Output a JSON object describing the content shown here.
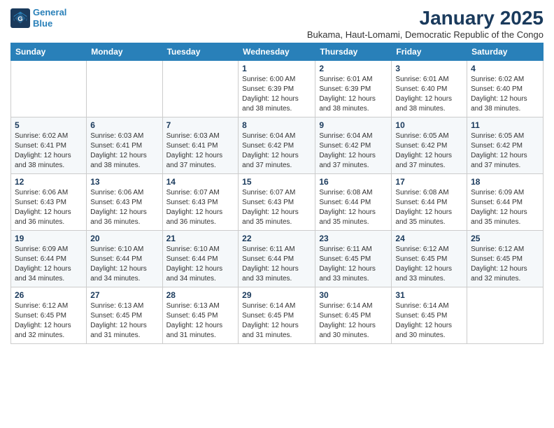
{
  "logo": {
    "line1": "General",
    "line2": "Blue"
  },
  "title": "January 2025",
  "subtitle": "Bukama, Haut-Lomami, Democratic Republic of the Congo",
  "weekdays": [
    "Sunday",
    "Monday",
    "Tuesday",
    "Wednesday",
    "Thursday",
    "Friday",
    "Saturday"
  ],
  "weeks": [
    [
      {
        "day": "",
        "info": ""
      },
      {
        "day": "",
        "info": ""
      },
      {
        "day": "",
        "info": ""
      },
      {
        "day": "1",
        "info": "Sunrise: 6:00 AM\nSunset: 6:39 PM\nDaylight: 12 hours\nand 38 minutes."
      },
      {
        "day": "2",
        "info": "Sunrise: 6:01 AM\nSunset: 6:39 PM\nDaylight: 12 hours\nand 38 minutes."
      },
      {
        "day": "3",
        "info": "Sunrise: 6:01 AM\nSunset: 6:40 PM\nDaylight: 12 hours\nand 38 minutes."
      },
      {
        "day": "4",
        "info": "Sunrise: 6:02 AM\nSunset: 6:40 PM\nDaylight: 12 hours\nand 38 minutes."
      }
    ],
    [
      {
        "day": "5",
        "info": "Sunrise: 6:02 AM\nSunset: 6:41 PM\nDaylight: 12 hours\nand 38 minutes."
      },
      {
        "day": "6",
        "info": "Sunrise: 6:03 AM\nSunset: 6:41 PM\nDaylight: 12 hours\nand 38 minutes."
      },
      {
        "day": "7",
        "info": "Sunrise: 6:03 AM\nSunset: 6:41 PM\nDaylight: 12 hours\nand 37 minutes."
      },
      {
        "day": "8",
        "info": "Sunrise: 6:04 AM\nSunset: 6:42 PM\nDaylight: 12 hours\nand 37 minutes."
      },
      {
        "day": "9",
        "info": "Sunrise: 6:04 AM\nSunset: 6:42 PM\nDaylight: 12 hours\nand 37 minutes."
      },
      {
        "day": "10",
        "info": "Sunrise: 6:05 AM\nSunset: 6:42 PM\nDaylight: 12 hours\nand 37 minutes."
      },
      {
        "day": "11",
        "info": "Sunrise: 6:05 AM\nSunset: 6:42 PM\nDaylight: 12 hours\nand 37 minutes."
      }
    ],
    [
      {
        "day": "12",
        "info": "Sunrise: 6:06 AM\nSunset: 6:43 PM\nDaylight: 12 hours\nand 36 minutes."
      },
      {
        "day": "13",
        "info": "Sunrise: 6:06 AM\nSunset: 6:43 PM\nDaylight: 12 hours\nand 36 minutes."
      },
      {
        "day": "14",
        "info": "Sunrise: 6:07 AM\nSunset: 6:43 PM\nDaylight: 12 hours\nand 36 minutes."
      },
      {
        "day": "15",
        "info": "Sunrise: 6:07 AM\nSunset: 6:43 PM\nDaylight: 12 hours\nand 35 minutes."
      },
      {
        "day": "16",
        "info": "Sunrise: 6:08 AM\nSunset: 6:44 PM\nDaylight: 12 hours\nand 35 minutes."
      },
      {
        "day": "17",
        "info": "Sunrise: 6:08 AM\nSunset: 6:44 PM\nDaylight: 12 hours\nand 35 minutes."
      },
      {
        "day": "18",
        "info": "Sunrise: 6:09 AM\nSunset: 6:44 PM\nDaylight: 12 hours\nand 35 minutes."
      }
    ],
    [
      {
        "day": "19",
        "info": "Sunrise: 6:09 AM\nSunset: 6:44 PM\nDaylight: 12 hours\nand 34 minutes."
      },
      {
        "day": "20",
        "info": "Sunrise: 6:10 AM\nSunset: 6:44 PM\nDaylight: 12 hours\nand 34 minutes."
      },
      {
        "day": "21",
        "info": "Sunrise: 6:10 AM\nSunset: 6:44 PM\nDaylight: 12 hours\nand 34 minutes."
      },
      {
        "day": "22",
        "info": "Sunrise: 6:11 AM\nSunset: 6:44 PM\nDaylight: 12 hours\nand 33 minutes."
      },
      {
        "day": "23",
        "info": "Sunrise: 6:11 AM\nSunset: 6:45 PM\nDaylight: 12 hours\nand 33 minutes."
      },
      {
        "day": "24",
        "info": "Sunrise: 6:12 AM\nSunset: 6:45 PM\nDaylight: 12 hours\nand 33 minutes."
      },
      {
        "day": "25",
        "info": "Sunrise: 6:12 AM\nSunset: 6:45 PM\nDaylight: 12 hours\nand 32 minutes."
      }
    ],
    [
      {
        "day": "26",
        "info": "Sunrise: 6:12 AM\nSunset: 6:45 PM\nDaylight: 12 hours\nand 32 minutes."
      },
      {
        "day": "27",
        "info": "Sunrise: 6:13 AM\nSunset: 6:45 PM\nDaylight: 12 hours\nand 31 minutes."
      },
      {
        "day": "28",
        "info": "Sunrise: 6:13 AM\nSunset: 6:45 PM\nDaylight: 12 hours\nand 31 minutes."
      },
      {
        "day": "29",
        "info": "Sunrise: 6:14 AM\nSunset: 6:45 PM\nDaylight: 12 hours\nand 31 minutes."
      },
      {
        "day": "30",
        "info": "Sunrise: 6:14 AM\nSunset: 6:45 PM\nDaylight: 12 hours\nand 30 minutes."
      },
      {
        "day": "31",
        "info": "Sunrise: 6:14 AM\nSunset: 6:45 PM\nDaylight: 12 hours\nand 30 minutes."
      },
      {
        "day": "",
        "info": ""
      }
    ]
  ]
}
